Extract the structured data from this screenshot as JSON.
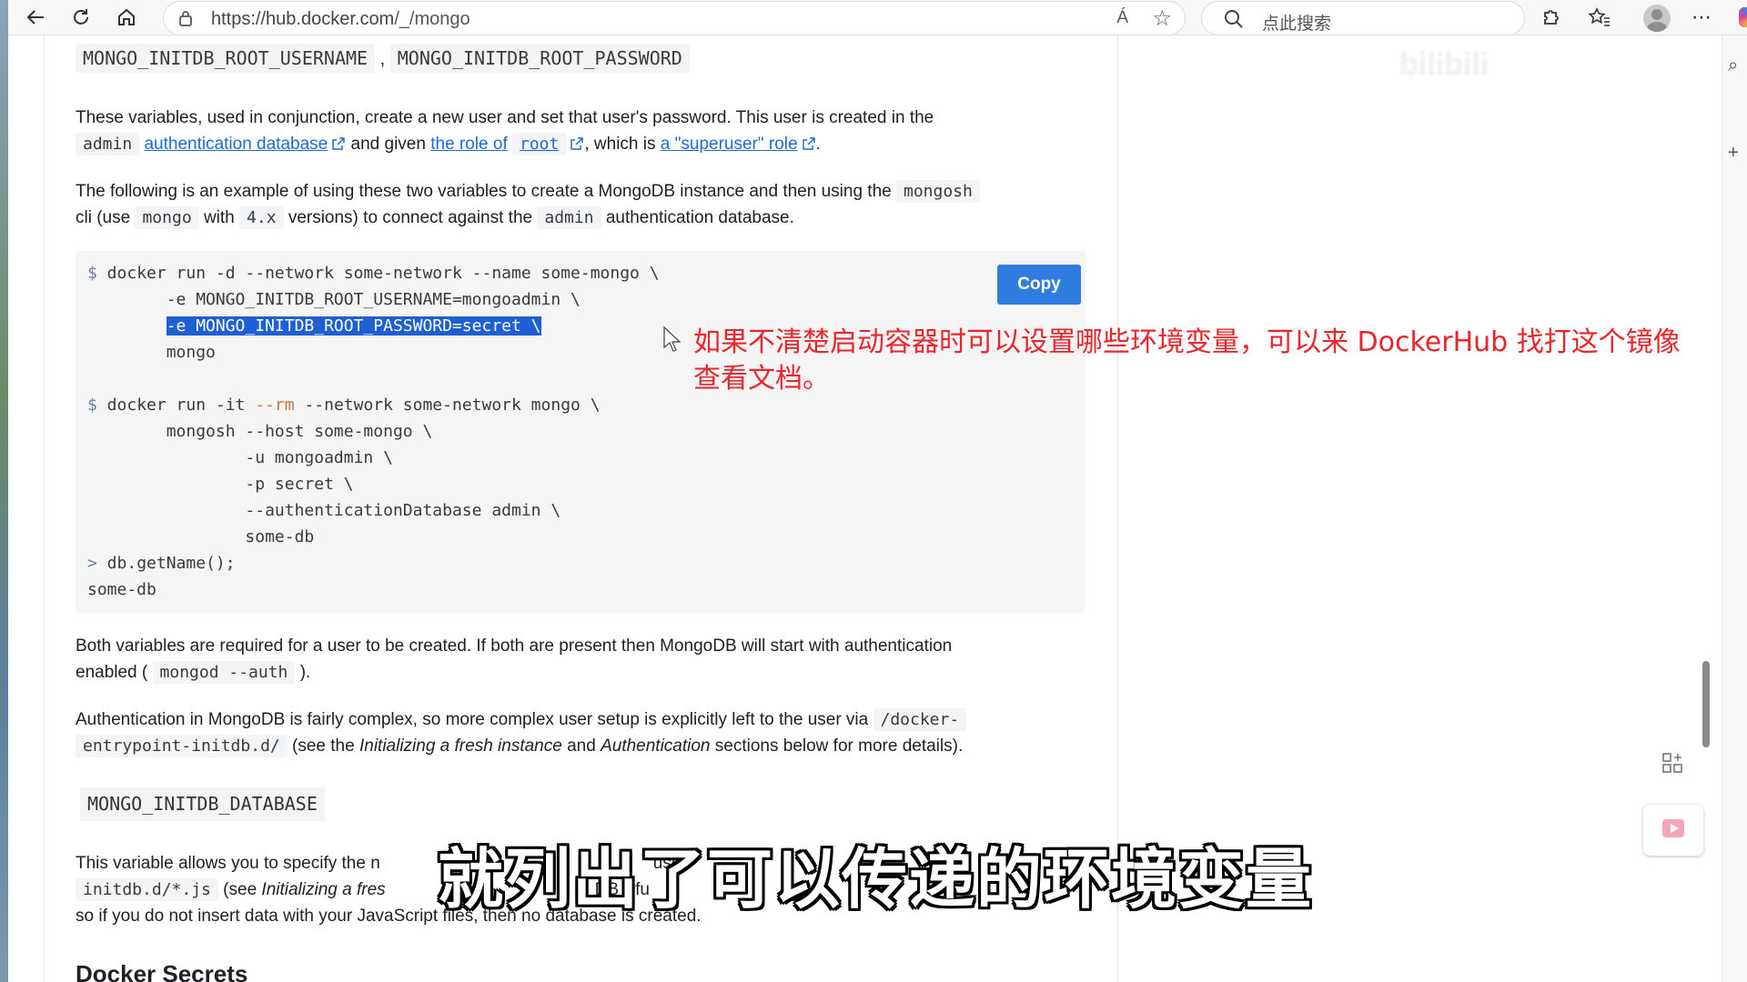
{
  "browser": {
    "url_host": "https://hub.docker.com",
    "url_path": "/_/mongo",
    "read_aloud_label": "Á",
    "search_placeholder": "点此搜索"
  },
  "watermark": "bilibili",
  "content": {
    "env1_name_a": "MONGO_INITDB_ROOT_USERNAME",
    "env1_sep": ",",
    "env1_name_b": "MONGO_INITDB_ROOT_PASSWORD",
    "p1": {
      "t1": "These variables, used in conjunction, create a new user and set that user's password. This user is created in the",
      "code_admin": "admin",
      "link_auth_db": "authentication database",
      "t2": "and given",
      "link_role_of": "the role of",
      "code_root": "root",
      "t3": ", which is",
      "link_superuser": "a \"superuser\" role",
      "t4": "."
    },
    "p2": {
      "t1": "The following is an example of using these two variables to create a MongoDB instance and then using the",
      "code_mongosh": "mongosh",
      "t2": "cli (use",
      "code_mongo": "mongo",
      "t3": "with",
      "code_4x": "4.x",
      "t4": "versions) to connect against the",
      "code_admin": "admin",
      "t5": "authentication database."
    },
    "code": {
      "copy_label": "Copy",
      "prompt": "$",
      "line1": " docker run -d --network some-network --name some-mongo \\",
      "line2": "        -e MONGO_INITDB_ROOT_USERNAME=mongoadmin \\",
      "line3_indent": "        ",
      "line3_highlight": "-e MONGO_INITDB_ROOT_PASSWORD=secret \\",
      "line4": "        mongo",
      "line6a": " docker run -it ",
      "line6_rm": "--rm",
      "line6b": " --network some-network mongo \\",
      "line7": "        mongosh --host some-mongo \\",
      "line8": "                -u mongoadmin \\",
      "line9": "                -p secret \\",
      "line10": "                --authenticationDatabase admin \\",
      "line11": "                some-db",
      "prompt2": ">",
      "line12": " db.getName();",
      "line13": "some-db"
    },
    "p3": {
      "t1": "Both variables are required for a user to be created. If both are present then MongoDB will start with authentication",
      "t2": "enabled (",
      "code_mongod": "mongod --auth",
      "t3": ")."
    },
    "p4": {
      "t1": "Authentication in MongoDB is fairly complex, so more complex user setup is explicitly left to the user via",
      "code_entry_a": "/docker-",
      "code_entry_b": "entrypoint-initdb.d/",
      "t2": "(see the",
      "em1": "Initializing a fresh instance",
      "t3": "and",
      "em2": "Authentication",
      "t4": "sections below for more details)."
    },
    "env2_name": "MONGO_INITDB_DATABASE",
    "p5": {
      "t1": "This variable allows you to specify the n",
      "t1b": "use",
      "code_initdb": "initdb.d/*.js",
      "t2": "(see",
      "em1": "Initializing a fres",
      "t2b": "DB",
      "t2c": "fu",
      "t3": "so if you do not insert data with your JavaScript files, then no database is created."
    },
    "heading_secrets": "Docker Secrets"
  },
  "annotation": "如果不清楚启动容器时可以设置哪些环境变量，可以来 DockerHub 找打这个镜像查看文档。",
  "subtitle": "就列出了可以传递的环境变量"
}
